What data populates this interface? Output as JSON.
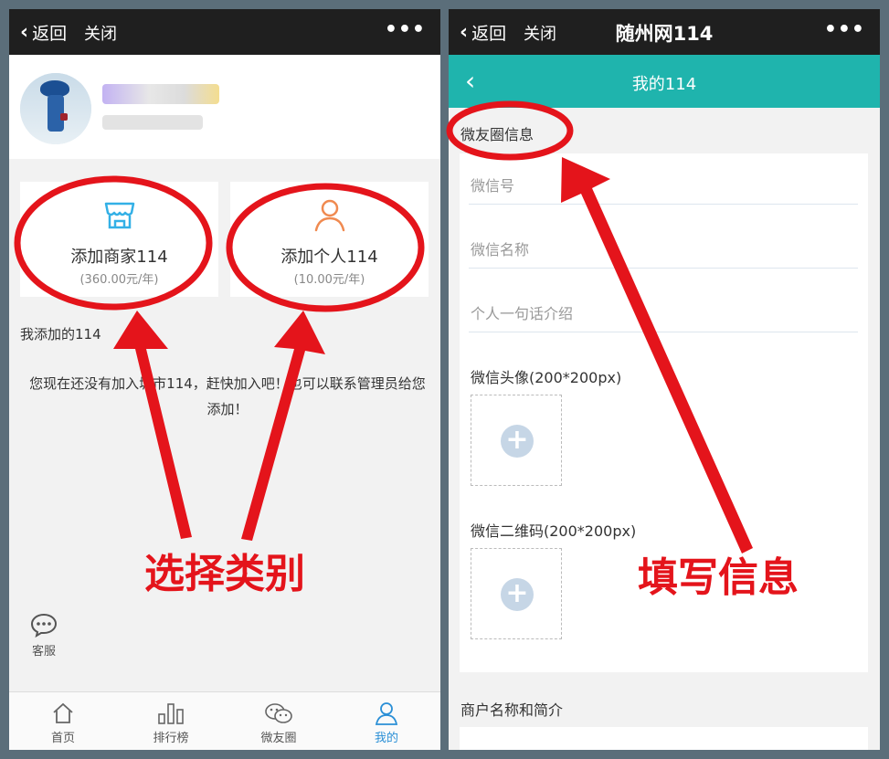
{
  "left": {
    "topbar": {
      "back": "返回",
      "close": "关闭",
      "more": "•••"
    },
    "cards": [
      {
        "name": "添加商家114",
        "price": "(360.00元/年)",
        "icon": "store-icon",
        "color": "#33b0e6"
      },
      {
        "name": "添加个人114",
        "price": "(10.00元/年)",
        "icon": "person-icon",
        "color": "#f08a50"
      }
    ],
    "section_title": "我添加的114",
    "empty_message": "您现在还没有加入城市114，赶快加入吧！也可以联系管理员给您添加！",
    "service_label": "客服",
    "tabs": [
      {
        "label": "首页",
        "icon": "home-icon"
      },
      {
        "label": "排行榜",
        "icon": "chart-icon"
      },
      {
        "label": "微友圈",
        "icon": "wechat-icon"
      },
      {
        "label": "我的",
        "icon": "user-icon",
        "active": true
      }
    ]
  },
  "right": {
    "topbar": {
      "back": "返回",
      "close": "关闭",
      "title": "随州网114",
      "more": "•••"
    },
    "appbar_title": "我的114",
    "section_wechat": "微友圈信息",
    "fields": [
      {
        "placeholder": "微信号"
      },
      {
        "placeholder": "微信名称"
      },
      {
        "placeholder": "个人一句话介绍"
      }
    ],
    "uploads": [
      {
        "label": "微信头像(200*200px)"
      },
      {
        "label": "微信二维码(200*200px)"
      }
    ],
    "section_merchant": "商户名称和简介"
  },
  "annotations": {
    "left_caption": "选择类别",
    "right_caption": "填写信息",
    "color": "#e4141b"
  }
}
